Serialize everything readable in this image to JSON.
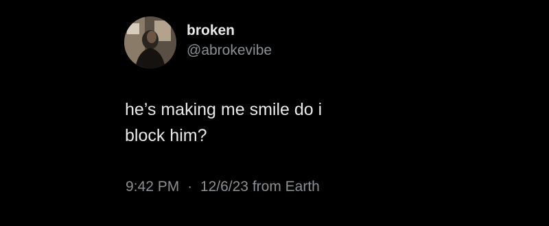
{
  "author": {
    "display_name": "broken",
    "handle": "@abrokevibe",
    "avatar_icon": "profile-photo-avatar"
  },
  "tweet": {
    "text": "he’s making me smile do i\nblock him?",
    "time": "9:42 PM",
    "separator": "·",
    "date": "12/6/23",
    "source": "from Earth"
  },
  "colors": {
    "background": "#000000",
    "primary_text": "#e7e9ea",
    "secondary_text": "#8b9095"
  }
}
